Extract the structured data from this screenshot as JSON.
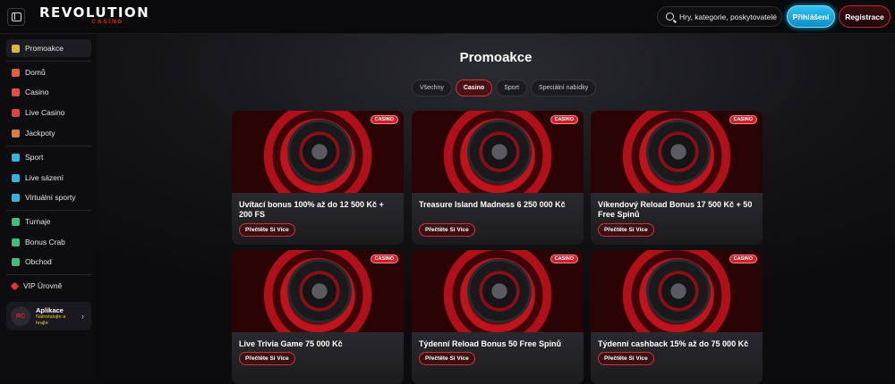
{
  "header": {
    "logo_main": "REVOLUTION",
    "logo_sub": "CASINO",
    "search_placeholder": "Hry, kategorie, poskytovatelé",
    "login_label": "Přihlášení",
    "register_label": "Registrace"
  },
  "sidebar": {
    "items": [
      {
        "label": "Promoakce",
        "icon": "gift-icon",
        "color": "#e0b43a"
      },
      {
        "label": "Domů",
        "icon": "home-icon",
        "color": "#e0603a"
      },
      {
        "label": "Casino",
        "icon": "slot-icon",
        "color": "#e0503a"
      },
      {
        "label": "Live Casino",
        "icon": "live-casino-icon",
        "color": "#e04040"
      },
      {
        "label": "Jackpoty",
        "icon": "jackpot-icon",
        "color": "#e07a3a"
      },
      {
        "label": "Sport",
        "icon": "sport-icon",
        "color": "#2fb6e0"
      },
      {
        "label": "Live sázení",
        "icon": "live-bet-icon",
        "color": "#2fb6e0"
      },
      {
        "label": "Virtuální sporty",
        "icon": "virtual-sport-icon",
        "color": "#2fb6e0"
      },
      {
        "label": "Turnaje",
        "icon": "trophy-icon",
        "color": "#3fc07a"
      },
      {
        "label": "Bonus Crab",
        "icon": "crab-icon",
        "color": "#3fc07a"
      },
      {
        "label": "Obchod",
        "icon": "shop-icon",
        "color": "#3fc07a"
      },
      {
        "label": "VIP Úrovně",
        "icon": "vip-icon",
        "color": "#e0303a"
      }
    ],
    "app": {
      "logo": "RC",
      "title": "Aplikace",
      "subtitle": "Nainstalujte a hrajte"
    }
  },
  "main": {
    "title": "Promoakce",
    "filters": [
      "Všechny",
      "Casino",
      "Sport",
      "Speciální nabídky"
    ],
    "active_filter": "Casino",
    "cards": [
      {
        "badge": "CASINO",
        "title": "Uvítací bonus 100% až do 12 500 Kč + 200 FS",
        "button": "Přečtěte Si Více"
      },
      {
        "badge": "CASINO",
        "title": "Treasure Island Madness 6 250 000 Kč",
        "button": "Přečtěte Si Více"
      },
      {
        "badge": "CASINO",
        "title": "Víkendový Reload Bonus 17 500 Kč + 50 Free Spinů",
        "button": "Přečtěte Si Více"
      },
      {
        "badge": "CASINO",
        "title": "Live Trivia Game 75 000 Kč",
        "button": "Přečtěte Si Více"
      },
      {
        "badge": "CASINO",
        "title": "Týdenní Reload Bonus 50 Free Spinů",
        "button": "Přečtěte Si Více"
      },
      {
        "badge": "CASINO",
        "title": "Týdenní cashback 15% až do 75 000 Kč",
        "button": "Přečtěte Si Více"
      }
    ]
  },
  "colors": {
    "accent_red": "#d0202a",
    "login_blue": "#1aa8e0",
    "background": "#0b0b0d"
  }
}
